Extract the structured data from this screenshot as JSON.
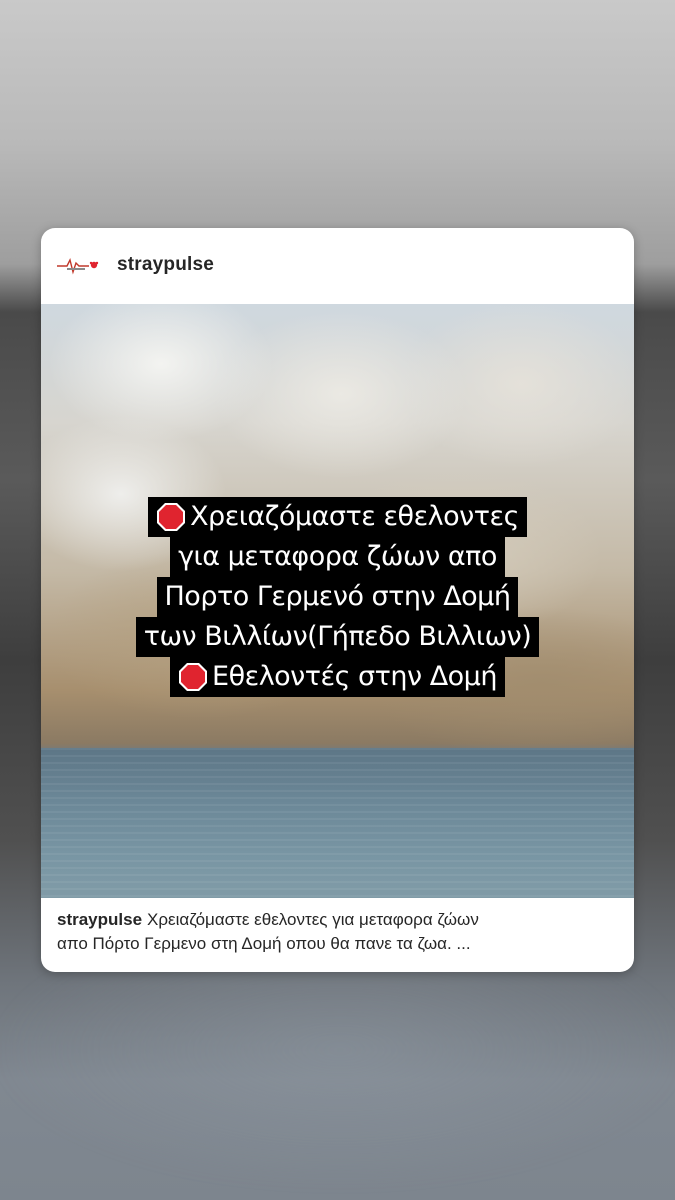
{
  "post": {
    "username": "straypulse",
    "avatar_icon": "straypulse-logo",
    "image": {
      "overlay_lines": [
        "Χρειαζόμαστε εθελοντες",
        "για μεταφορα ζώων απο",
        "Πορτο Γερμενό στην Δομή",
        "των Βιλλίων(Γήπεδο Βιλλιων)",
        "Εθελοντές στην Δομή"
      ],
      "stop_icon": "stop-sign-icon"
    },
    "caption": {
      "username": "straypulse",
      "line1": "Χρειαζόμαστε εθελοντες για μεταφορα ζώων",
      "line2": "απο Πόρτο Γερμενο στη  Δομή οπου θα πανε τα ζωα. ..."
    }
  },
  "colors": {
    "card_bg": "#ffffff",
    "text": "#262626",
    "overlay_bg": "#000000",
    "overlay_text": "#ffffff",
    "stop_red": "#e0242f"
  }
}
